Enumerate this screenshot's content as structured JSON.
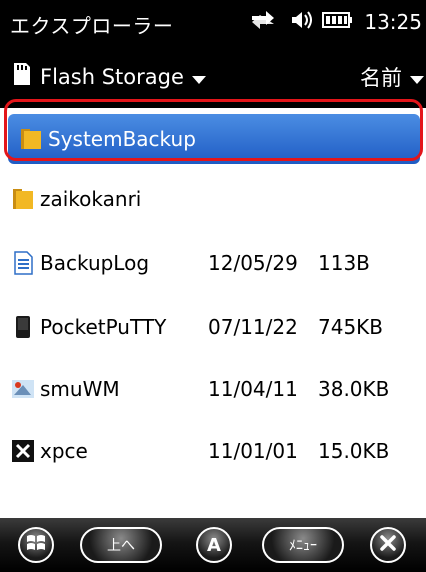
{
  "statusbar": {
    "title": "エクスプローラー",
    "time": "13:25"
  },
  "header": {
    "storage_label": "Flash Storage",
    "sort_label": "名前"
  },
  "files": [
    {
      "name": "SystemBackup",
      "date": "",
      "size": "",
      "icon": "folder-icon",
      "selected": true
    },
    {
      "name": "zaikokanri",
      "date": "",
      "size": "",
      "icon": "folder-icon",
      "selected": false
    },
    {
      "name": "BackupLog",
      "date": "12/05/29",
      "size": "113B",
      "icon": "document-icon",
      "selected": false
    },
    {
      "name": "PocketPuTTY",
      "date": "07/11/22",
      "size": "745KB",
      "icon": "device-icon",
      "selected": false
    },
    {
      "name": "smuWM",
      "date": "11/04/11",
      "size": "38.0KB",
      "icon": "application-icon",
      "selected": false
    },
    {
      "name": "xpce",
      "date": "11/01/01",
      "size": "15.0KB",
      "icon": "x-app-icon",
      "selected": false
    }
  ],
  "softkeys": {
    "up_label": "上へ",
    "a_label": "A",
    "menu_label": "ﾒﾆｭｰ"
  },
  "colors": {
    "selection": "#2b6cd3",
    "highlight_box": "#e3151a",
    "folder": "#f2b824"
  }
}
